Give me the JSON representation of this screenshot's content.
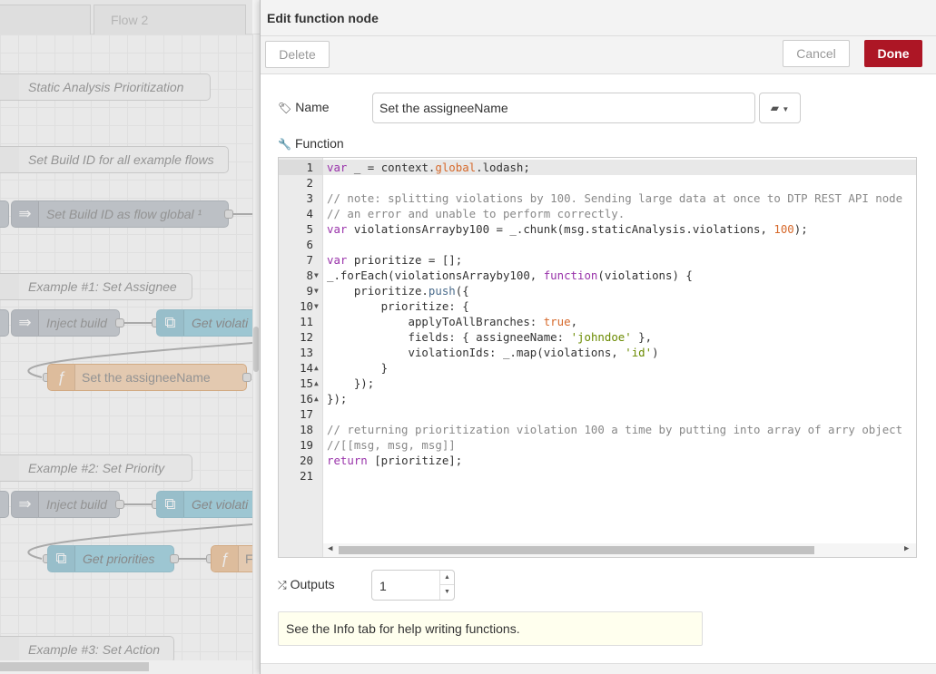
{
  "canvas": {
    "tabs": [
      "",
      "Flow 2"
    ],
    "nodes": [
      {
        "kind": "comment",
        "label": "Static Analysis Prioritization"
      },
      {
        "kind": "comment",
        "label": "Set Build ID for all example flows"
      },
      {
        "kind": "inject",
        "label": "Set Build ID as flow global ¹"
      },
      {
        "kind": "comment",
        "label": "Example #1: Set Assignee"
      },
      {
        "kind": "inject",
        "label": "Inject build"
      },
      {
        "kind": "subflow",
        "label": "Get violati"
      },
      {
        "kind": "function",
        "label": "Set the assigneeName"
      },
      {
        "kind": "comment",
        "label": "Example #2: Set Priority"
      },
      {
        "kind": "inject",
        "label": "Inject build"
      },
      {
        "kind": "subflow",
        "label": "Get violati"
      },
      {
        "kind": "subflow",
        "label": "Get priorities"
      },
      {
        "kind": "function",
        "label": "F"
      },
      {
        "kind": "comment",
        "label": "Example #3: Set Action"
      }
    ]
  },
  "tray": {
    "title": "Edit function node",
    "delete_label": "Delete",
    "cancel_label": "Cancel",
    "done_label": "Done",
    "name_label": "Name",
    "name_value": "Set the assigneeName",
    "function_label": "Function",
    "outputs_label": "Outputs",
    "outputs_value": "1",
    "tip": "See the Info tab for help writing functions."
  },
  "code": {
    "lines": [
      "var _ = context.global.lodash;",
      "",
      "// note: splitting violations by 100. Sending large data at once to DTP REST API node",
      "// an error and unable to perform correctly.",
      "var violationsArrayby100 = _.chunk(msg.staticAnalysis.violations, 100);",
      "",
      "var prioritize = [];",
      "_.forEach(violationsArrayby100, function(violations) {",
      "    prioritize.push({",
      "        prioritize: {",
      "            applyToAllBranches: true,",
      "            fields: { assigneeName: 'johndoe' },",
      "            violationIds: _.map(violations, 'id')",
      "        }",
      "    });",
      "});",
      "",
      "// returning prioritization violation 100 a time by putting into array of arry object",
      "//[[msg, msg, msg]]",
      "return [prioritize];",
      ""
    ],
    "folds": {
      "8": "down",
      "9": "down",
      "10": "down",
      "14": "up",
      "15": "up",
      "16": "up"
    }
  },
  "colors": {
    "done": "#ad1625",
    "keyword": "#9933aa",
    "comment": "#888888",
    "number": "#d6692b",
    "string": "#6a8a00"
  }
}
